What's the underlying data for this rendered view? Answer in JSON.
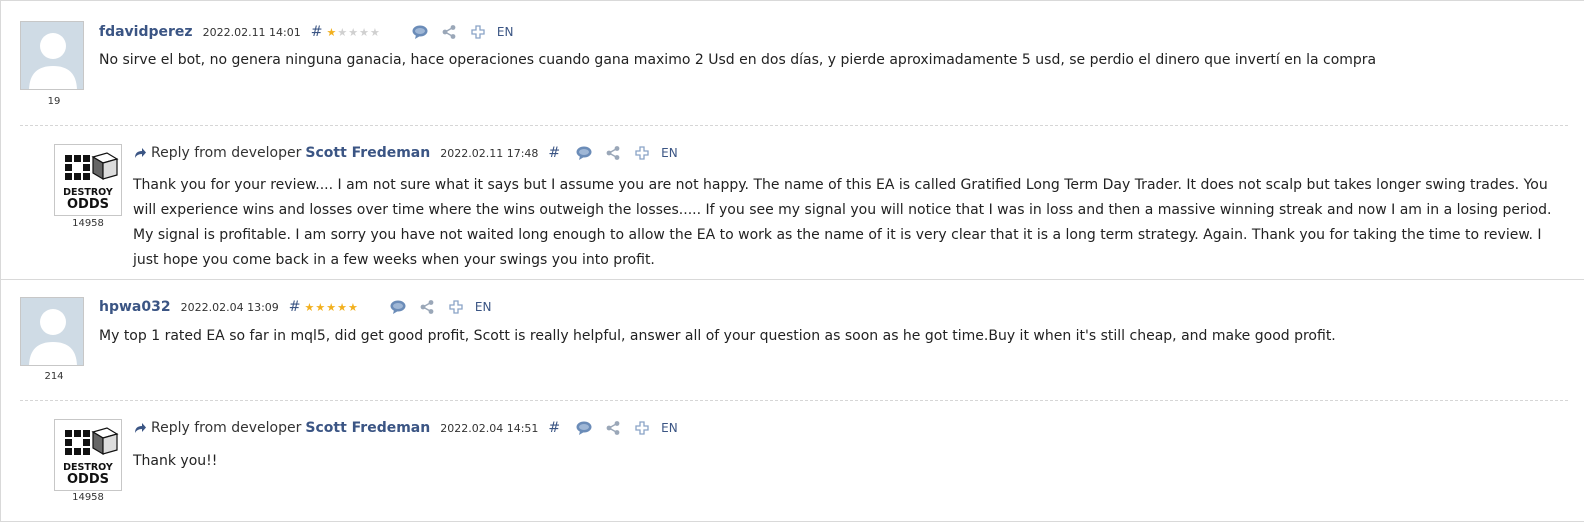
{
  "reviews": [
    {
      "username": "fdavidperez",
      "date": "2022.02.11 14:01",
      "hash": "#",
      "rating": 1,
      "lang": "EN",
      "count": "19",
      "text": "No sirve el bot, no genera ninguna ganacia, hace operaciones cuando gana maximo 2 Usd en dos días, y pierde aproximadamente 5 usd, se perdio el dinero que invertí en la compra",
      "reply": {
        "prefix": "Reply from developer",
        "developer": "Scott Fredeman",
        "date": "2022.02.11 17:48",
        "hash": "#",
        "lang": "EN",
        "count": "14958",
        "lines": [
          "Thank you for your review.... I am not sure what it says but I assume you are not happy. The name of this EA is called Gratified Long Term Day Trader. It does not scalp but takes longer swing trades. You",
          "will experience wins and losses over time where the wins outweigh the losses..... If you see my signal you will notice that I was in loss and then a massive winning streak and now I am in a losing period.",
          "My signal is profitable. I am sorry you have not waited long enough to allow the EA to work as the name of it is very clear that it is a long term strategy. Again. Thank you for taking the time to review. I",
          "just hope you come back in a few weeks when your swings you into profit."
        ]
      }
    },
    {
      "username": "hpwa032",
      "date": "2022.02.04 13:09",
      "hash": "#",
      "rating": 5,
      "lang": "EN",
      "count": "214",
      "text": "My top 1 rated EA so far in mql5, did get good profit, Scott is really helpful, answer all of your question as soon as he got time.Buy it when it's still cheap, and make good profit.",
      "reply": {
        "prefix": "Reply from developer",
        "developer": "Scott Fredeman",
        "date": "2022.02.04 14:51",
        "hash": "#",
        "lang": "EN",
        "count": "14958",
        "lines": [
          "Thank you!!"
        ]
      }
    }
  ],
  "logo_text": [
    "DESTROY",
    "ODDS"
  ],
  "colors": {
    "link": "#3b5584",
    "star_on": "#f2b01e",
    "star_off": "#d0d0d0",
    "icon": "#6b8cb8"
  },
  "icons": [
    "comment-icon",
    "share-icon",
    "add-icon",
    "reply-arrow-icon"
  ]
}
